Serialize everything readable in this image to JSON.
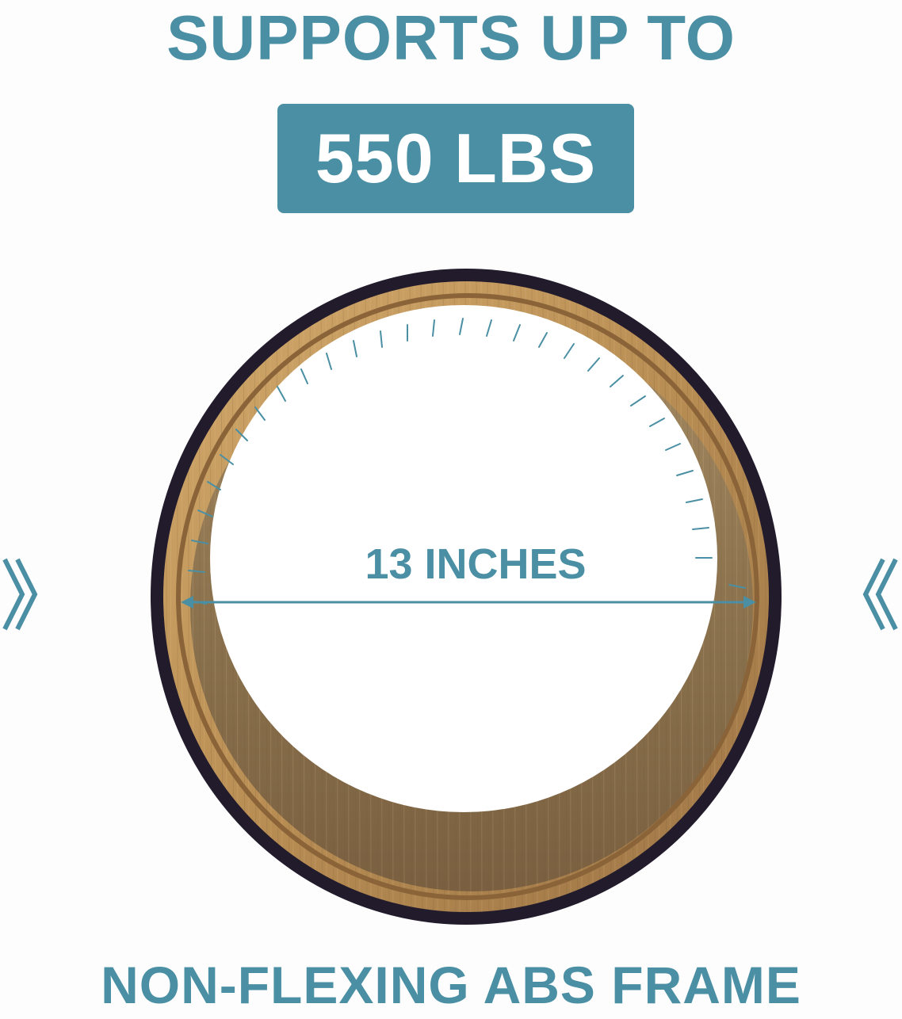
{
  "headline": "SUPPORTS UP TO",
  "badge": "550 LBS",
  "measurement": "13 INCHES",
  "footer": "NON-FLEXING ABS FRAME",
  "colors": {
    "accent": "#4a8fa3",
    "wood_light": "#c59a5f",
    "wood_dark": "#8b6a3e",
    "rim": "#221b2c"
  },
  "icons": {
    "left": "double-chevron-right-icon",
    "right": "double-chevron-left-icon"
  }
}
